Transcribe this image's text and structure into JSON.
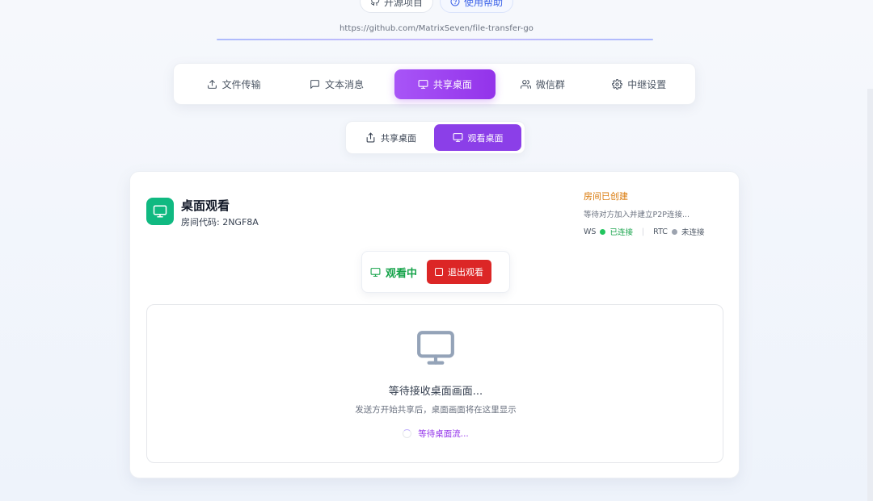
{
  "header": {
    "open_source_label": "开源项目",
    "help_label": "使用帮助",
    "url": "https://github.com/MatrixSeven/file-transfer-go"
  },
  "main_tabs": [
    {
      "label": "文件传输",
      "icon": "upload-icon",
      "active": false
    },
    {
      "label": "文本消息",
      "icon": "message-icon",
      "active": false
    },
    {
      "label": "共享桌面",
      "icon": "monitor-icon",
      "active": true
    },
    {
      "label": "微信群",
      "icon": "users-icon",
      "active": false
    },
    {
      "label": "中继设置",
      "icon": "gear-icon",
      "active": false
    }
  ],
  "sub_tabs": [
    {
      "label": "共享桌面",
      "icon": "share-icon",
      "active": false
    },
    {
      "label": "观看桌面",
      "icon": "monitor-icon",
      "active": true
    }
  ],
  "card": {
    "title": "桌面观看",
    "room_code": "房间代码: 2NGF8A",
    "status_title": "房间已创建",
    "status_sub": "等待对方加入并建立P2P连接...",
    "ws_label": "WS",
    "ws_status": "已连接",
    "rtc_label": "RTC",
    "rtc_status": "未连接",
    "watching_label": "观看中",
    "exit_label": "退出观看",
    "wait_title": "等待接收桌面画面...",
    "wait_sub": "发送方开始共享后，桌面画面将在这里显示",
    "wait_stream": "等待桌面流..."
  },
  "colors": {
    "accent": "#9333ea",
    "success": "#16a34a",
    "danger": "#dc2626",
    "warning": "#d97706",
    "card_icon": "#10b981"
  }
}
